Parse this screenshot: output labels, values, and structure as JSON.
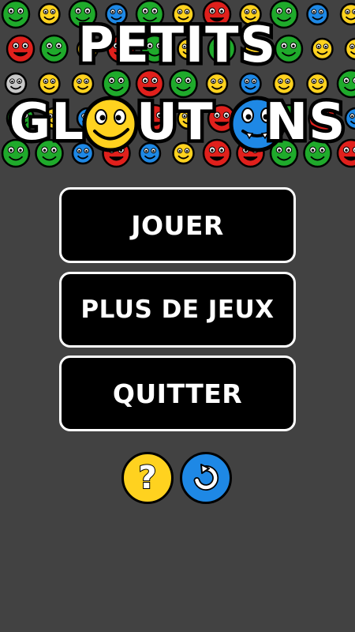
{
  "title": {
    "line1": "PETITS",
    "line2": "GLOUTONS"
  },
  "menu": {
    "play_label": "JOUER",
    "more_games_label": "PLUS DE JEUX",
    "quit_label": "QUITTER"
  },
  "icons": {
    "help": "question-mark-icon",
    "help_glyph": "?",
    "restore": "refresh-icon"
  },
  "colors": {
    "background": "#424242",
    "button_fill": "#000000",
    "button_border": "#ffffff",
    "help_button": "#ffd21f",
    "restore_button": "#1e88e5",
    "creature_green": "#1faa2b",
    "creature_yellow": "#ffd21f",
    "creature_red": "#e0201c",
    "creature_blue": "#1e88e5",
    "creature_gray": "#c8c8c8"
  },
  "creature_rows": [
    [
      "green",
      "yellow",
      "green",
      "blue",
      "green",
      "yellow",
      "red",
      "yellow",
      "green",
      "blue",
      "yellow"
    ],
    [
      "red",
      "green",
      "yellow",
      "red",
      "green",
      "yellow",
      "green",
      "yellow",
      "green",
      "yellow",
      "yellow"
    ],
    [
      "gray",
      "yellow",
      "yellow",
      "green",
      "red",
      "green",
      "yellow",
      "blue",
      "yellow",
      "yellow",
      "green"
    ],
    [
      "green",
      "yellow",
      "blue",
      "green",
      "red",
      "yellow",
      "red",
      "blue",
      "green",
      "red",
      "blue"
    ],
    [
      "green",
      "green",
      "blue",
      "red",
      "blue",
      "yellow",
      "red",
      "red",
      "green",
      "green",
      "red"
    ]
  ]
}
